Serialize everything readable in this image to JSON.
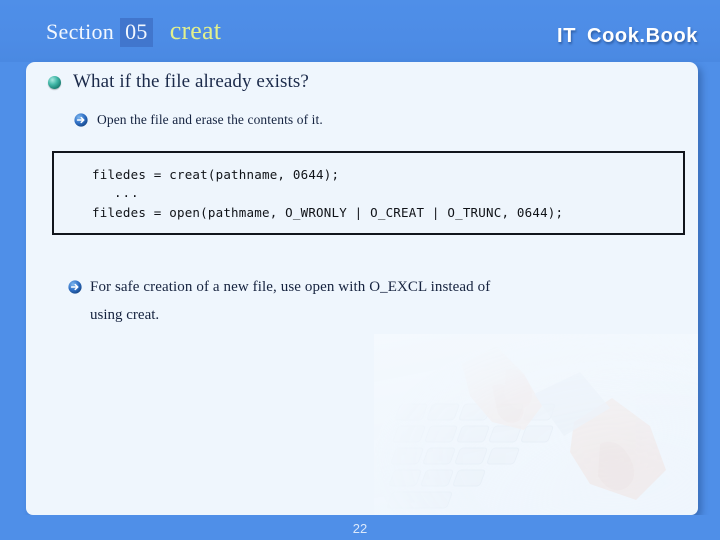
{
  "header": {
    "section_label": "Section",
    "section_number": "05",
    "topic": "creat",
    "logo_it": "IT",
    "logo_cookbook": "Cook.Book"
  },
  "content": {
    "bullet_main": "What if the file already exists?",
    "bullet_sub": "Open the file and erase the contents of it.",
    "code": {
      "line1": "filedes = creat(pathname, 0644);",
      "line2": "...",
      "line3": "filedes = open(pathmame, O_WRONLY | O_CREAT | O_TRUNC, 0644);"
    },
    "note_line1": "For safe creation of  a new file, use open with O_EXCL instead of",
    "note_line2": "using creat."
  },
  "footer": {
    "page_number": "22"
  },
  "icons": {
    "sphere": "sphere-bullet-icon",
    "arrow": "arrow-bullet-icon",
    "watermark": "keyboard-hands-watermark"
  },
  "colors": {
    "background_blue": "#4f8fe8",
    "panel": "#eff6fd",
    "topic_yellow": "#e2f08c",
    "number_highlight": "#4176cd",
    "text_navy": "#16233f",
    "code_border": "#11151c"
  }
}
